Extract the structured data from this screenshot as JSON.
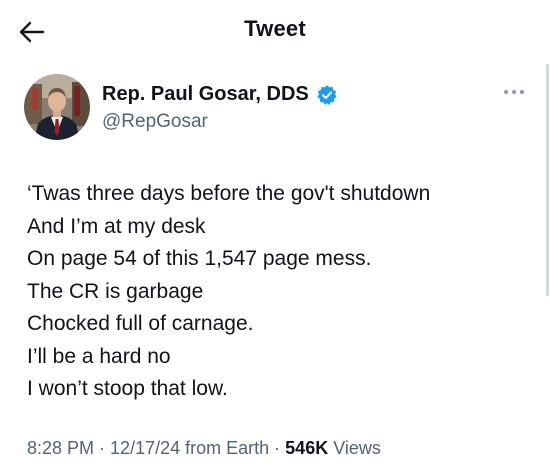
{
  "header": {
    "back_icon": "arrow-left-icon",
    "title": "Tweet"
  },
  "author": {
    "name": "Rep. Paul Gosar, DDS",
    "handle": "@RepGosar",
    "verified_icon": "verified-badge-icon",
    "verified_color": "#1d9bf0",
    "avatar_icon": "avatar-photo",
    "more_icon": "more-horizontal-icon"
  },
  "tweet": {
    "lines": [
      "‘Twas three days before the gov't shutdown",
      "And I’m at my desk",
      "On page 54 of this 1,547 page mess.",
      "The CR is garbage",
      "Chocked full of carnage.",
      "I’ll be a hard no",
      "I won’t stoop that low."
    ]
  },
  "meta": {
    "time": "8:28 PM",
    "separator": " · ",
    "date": "12/17/24",
    "source": "from Earth",
    "views_count": "546K",
    "views_label": "Views"
  },
  "colors": {
    "text": "#0f1419",
    "secondary": "#536471",
    "accent": "#1d9bf0"
  }
}
